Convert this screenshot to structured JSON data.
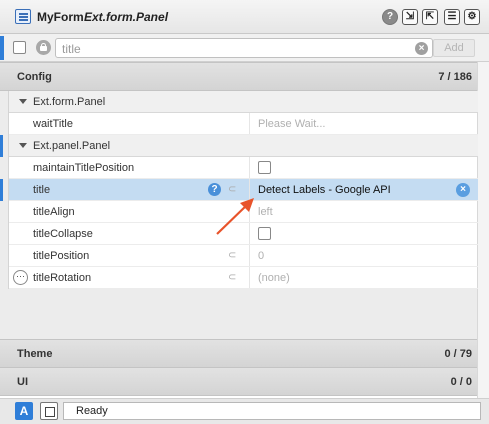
{
  "header": {
    "component_name": "MyForm",
    "component_class": "Ext.form.Panel"
  },
  "filter": {
    "placeholder": "title",
    "add_label": "Add"
  },
  "sections": {
    "config": {
      "label": "Config",
      "count": "7 / 186"
    },
    "theme": {
      "label": "Theme",
      "count": "0 / 79"
    },
    "ui": {
      "label": "UI",
      "count": "0 / 0"
    }
  },
  "groups": {
    "form_panel": "Ext.form.Panel",
    "panel": "Ext.panel.Panel"
  },
  "rows": {
    "waitTitle": {
      "name": "waitTitle",
      "value": "Please Wait..."
    },
    "maintainTitlePosition": {
      "name": "maintainTitlePosition",
      "checked": false
    },
    "title": {
      "name": "title",
      "value": "Detect Labels - Google API"
    },
    "titleAlign": {
      "name": "titleAlign",
      "value": "left"
    },
    "titleCollapse": {
      "name": "titleCollapse",
      "checked": false
    },
    "titlePosition": {
      "name": "titlePosition",
      "value": "0"
    },
    "titleRotation": {
      "name": "titleRotation",
      "value": "(none)"
    }
  },
  "status": {
    "a_label": "A",
    "text": "Ready"
  },
  "colors": {
    "accent": "#2f7ed8",
    "selection": "#c4dcf2",
    "arrow": "#e8532a"
  }
}
